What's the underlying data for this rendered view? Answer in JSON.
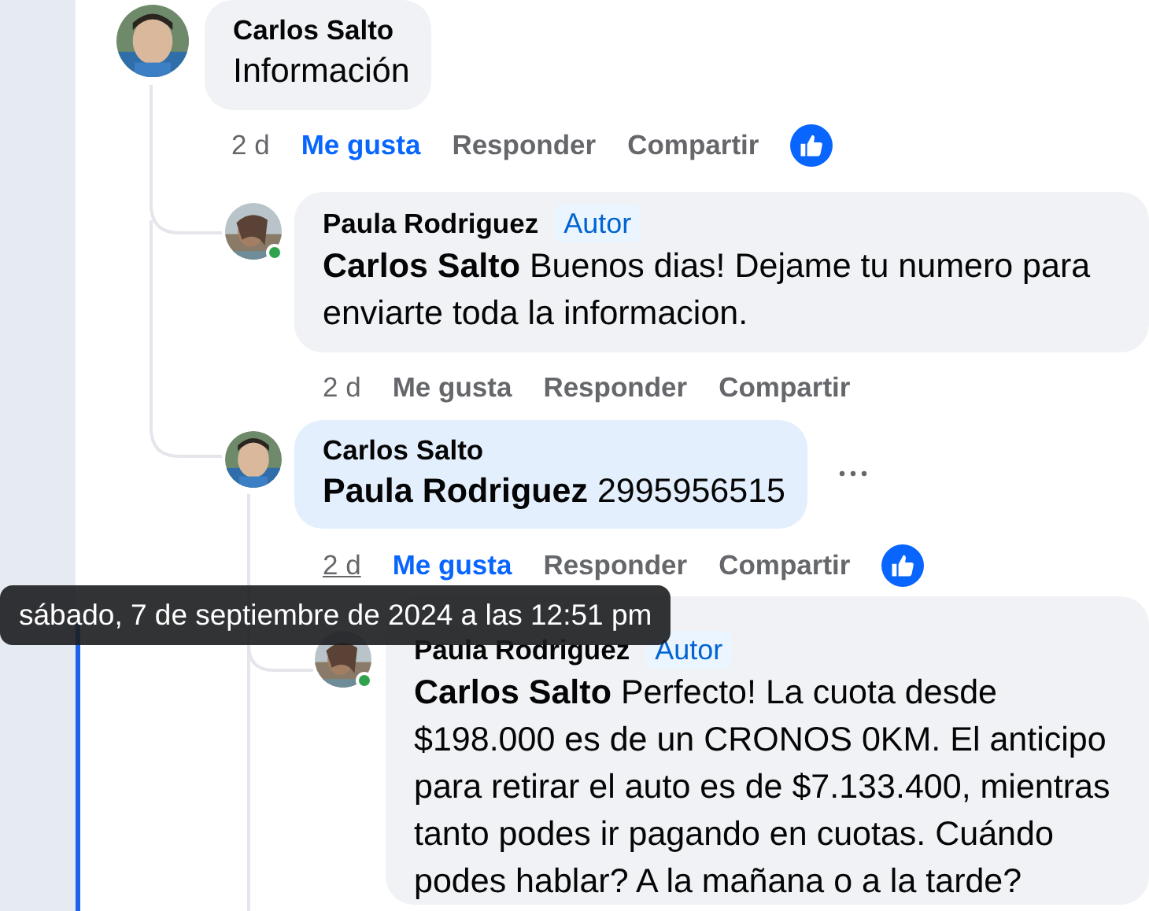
{
  "comments": [
    {
      "author": "Carlos Salto",
      "text": "Información",
      "highlighted": false,
      "time": "2 d",
      "time_hovered": false,
      "like": "Me gusta",
      "liked": true,
      "reply": "Responder",
      "share": "Compartir",
      "has_reaction": true,
      "replies": [
        {
          "author": "Paula Rodriguez",
          "online": true,
          "badge": "Autor",
          "mention": "Carlos Salto",
          "text": "Buenos dias! Dejame tu numero para enviarte toda la informacion.",
          "highlighted": false,
          "time": "2 d",
          "time_hovered": false,
          "like": "Me gusta",
          "liked": false,
          "reply": "Responder",
          "share": "Compartir"
        },
        {
          "author": "Carlos Salto",
          "mention": "Paula Rodriguez",
          "text": "2995956515",
          "highlighted": true,
          "show_more": true,
          "time": "2 d",
          "time_hovered": true,
          "like": "Me gusta",
          "liked": true,
          "reply": "Responder",
          "share": "Compartir",
          "has_reaction": true,
          "replies": [
            {
              "author": "Paula Rodriguez",
              "online": true,
              "badge": "Autor",
              "mention": "Carlos Salto",
              "text": "Perfecto! La cuota desde $198.000 es de un CRONOS 0KM. El anticipo para retirar el auto es de $7.133.400, mientras tanto podes ir pagando en cuotas. Cuándo podes hablar? A la mañana o a la tarde?",
              "highlighted": false
            }
          ]
        }
      ]
    }
  ],
  "tooltip": {
    "text": "sábado, 7 de septiembre de 2024 a las 12:51 pm"
  }
}
